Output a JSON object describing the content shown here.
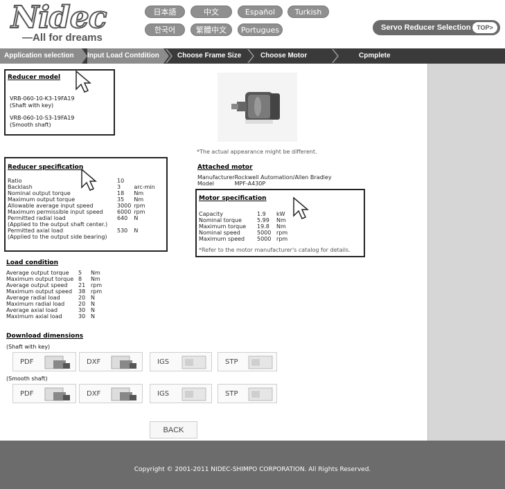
{
  "header": {
    "logo": "Nidec",
    "tagline": "All for dreams",
    "languages": [
      "日本語",
      "中文",
      "Español",
      "Turkish",
      "한국어",
      "繁體中文",
      "Portugues"
    ],
    "tool_label": "Servo Reducer Selection Tool",
    "top_label": "TOP>"
  },
  "steps": [
    "Application selection",
    "Input Load Contdition",
    "Choose Frame Size",
    "Choose Motor",
    "Cpmplete"
  ],
  "reducer_model": {
    "title": "Reducer model",
    "items": [
      {
        "code": "VRB-060-10-K3-19FA19",
        "note": "(Shaft with key)"
      },
      {
        "code": "VRB-060-10-S3-19FA19",
        "note": "(Smooth shaft)"
      }
    ]
  },
  "appearance_note": "*The actual appearance might be different.",
  "reducer_spec": {
    "title": "Reducer specification",
    "rows": [
      {
        "label": "Ratio",
        "value": "10",
        "unit": ""
      },
      {
        "label": "Backlash",
        "value": "3",
        "unit": "arc-min"
      },
      {
        "label": "Nominal output torque",
        "value": "18",
        "unit": "Nm"
      },
      {
        "label": "Maximum output torque",
        "value": "35",
        "unit": "Nm"
      },
      {
        "label": "Allowable average input speed",
        "value": "3000",
        "unit": "rpm"
      },
      {
        "label": "Maximum permissible input speed",
        "value": "6000",
        "unit": "rpm"
      },
      {
        "label": "Permitted radial load",
        "value": "640",
        "unit": "N"
      },
      {
        "label": "(Applied to the output shaft center.)",
        "value": "",
        "unit": ""
      },
      {
        "label": "Permitted axial load",
        "value": "530",
        "unit": "N"
      },
      {
        "label": "(Applied to the output side bearing)",
        "value": "",
        "unit": ""
      }
    ]
  },
  "attached_motor": {
    "title": "Attached motor",
    "manufacturer_label": "Manufacturer",
    "manufacturer": "Rockwell Automation/Allen Bradley",
    "model_label": "Model",
    "model": "MPF-A430P"
  },
  "motor_spec": {
    "title": "Motor specification",
    "rows": [
      {
        "label": "Capacity",
        "value": "1.9",
        "unit": "kW"
      },
      {
        "label": "Nominal torque",
        "value": "5.99",
        "unit": "Nm"
      },
      {
        "label": "Maximum torque",
        "value": "19.8",
        "unit": "Nm"
      },
      {
        "label": "Nominal speed",
        "value": "5000",
        "unit": "rpm"
      },
      {
        "label": "Maximum speed",
        "value": "5000",
        "unit": "rpm"
      }
    ],
    "note": "*Refer to the motor manufacturer's catalog for details."
  },
  "load_condition": {
    "title": "Load condition",
    "rows": [
      {
        "label": "Average output torque",
        "value": "5",
        "unit": "Nm"
      },
      {
        "label": "Maximum output torque",
        "value": "8",
        "unit": "Nm"
      },
      {
        "label": "Average output speed",
        "value": "21",
        "unit": "rpm"
      },
      {
        "label": "Maximum output speed",
        "value": "38",
        "unit": "rpm"
      },
      {
        "label": "Average radial load",
        "value": "20",
        "unit": "N"
      },
      {
        "label": "Maximum radial load",
        "value": "20",
        "unit": "N"
      },
      {
        "label": "Average axial load",
        "value": "30",
        "unit": "N"
      },
      {
        "label": "Maximum axial load",
        "value": "30",
        "unit": "N"
      }
    ]
  },
  "downloads": {
    "title": "Download dimensions",
    "groups": [
      {
        "label": "(Shaft with key)"
      },
      {
        "label": "(Smooth shaft)"
      }
    ],
    "formats": [
      "PDF",
      "DXF",
      "IGS",
      "STP"
    ]
  },
  "back_label": "BACK",
  "footer": "Copyright © 2001-2011 NIDEC-SHIMPO CORPORATION. All Rights Reserved."
}
